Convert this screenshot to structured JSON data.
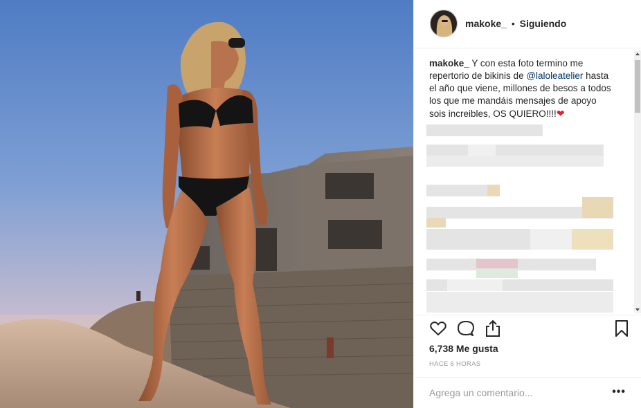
{
  "post": {
    "username": "makoke_",
    "dot": "•",
    "follow_status": "Siguiendo",
    "caption_user": "makoke_",
    "caption_part1": "Y con esta foto termino me repertorio de bikinis de",
    "caption_mention": "@laloleatelier",
    "caption_part2": "hasta el año que viene, millones de besos a todos los que me mandáis mensajes de apoyo sois increibles, OS QUIERO!!!!",
    "heart": "❤"
  },
  "stats": {
    "likes": "6,738 Me gusta",
    "time": "HACE 6 HORAS"
  },
  "comment_box": {
    "placeholder": "Agrega un comentario...",
    "more": "•••"
  },
  "icons": {
    "like": "heart-outline-icon",
    "comment": "speech-bubble-icon",
    "share": "share-icon",
    "save": "bookmark-icon"
  },
  "colors": {
    "text": "#262626",
    "mention": "#003569",
    "muted": "#999999",
    "heart": "#ed1c24"
  }
}
